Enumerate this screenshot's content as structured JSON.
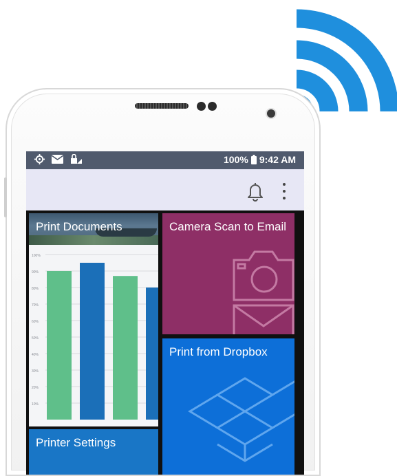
{
  "status_bar": {
    "battery": "100%",
    "time": "9:42 AM",
    "left_icons": [
      "settings-icon",
      "mail-icon",
      "lock-wifi-icon"
    ],
    "right_icons": [
      "battery-icon"
    ]
  },
  "app_bar": {
    "icons": [
      "bell-icon",
      "more-vert-icon"
    ]
  },
  "tiles": {
    "print_documents": {
      "label": "Print Documents",
      "color": "#f4f5f7"
    },
    "camera_scan": {
      "label": "Camera Scan to Email",
      "color": "#8e2f66",
      "icons": [
        "camera-icon",
        "envelope-icon"
      ]
    },
    "dropbox": {
      "label": "Print from Dropbox",
      "color": "#0d6fd8",
      "icons": [
        "dropbox-icon"
      ]
    },
    "printer_settings": {
      "label": "Printer Settings",
      "color": "#1976c6"
    }
  },
  "chart_data": {
    "type": "bar",
    "yticks": [
      "100%",
      "90%",
      "80%",
      "70%",
      "60%",
      "50%",
      "40%",
      "30%",
      "20%",
      "10%"
    ],
    "ylim": [
      0,
      100
    ],
    "values": [
      90,
      95,
      87,
      80
    ],
    "colors": [
      "#5fbf8a",
      "#1b6fb8",
      "#5fbf8a",
      "#1b6fb8"
    ]
  },
  "colors": {
    "wifi": "#1f8fdd",
    "status_bar": "#505a6d",
    "app_bar": "#e7e7f5"
  }
}
